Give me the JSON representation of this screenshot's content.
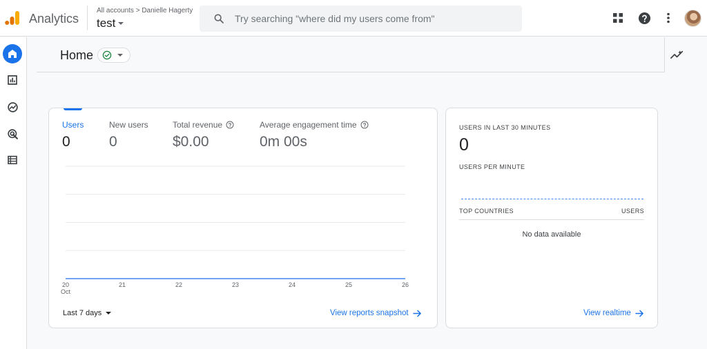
{
  "topbar": {
    "app_name": "Analytics",
    "breadcrumb": "All accounts > Danielle Hagerty",
    "property": "test",
    "search_placeholder": "Try searching \"where did my users come from\"",
    "icons": [
      "apps-grid-icon",
      "help-icon",
      "more-vert-icon",
      "avatar"
    ]
  },
  "nav": {
    "items": [
      {
        "name": "home",
        "icon": "home-icon",
        "active": true
      },
      {
        "name": "reports",
        "icon": "bar-chart-icon",
        "active": false
      },
      {
        "name": "explore",
        "icon": "explore-icon",
        "active": false
      },
      {
        "name": "advertising",
        "icon": "target-icon",
        "active": false
      },
      {
        "name": "configure",
        "icon": "list-icon",
        "active": false
      }
    ]
  },
  "page": {
    "title": "Home"
  },
  "metrics": [
    {
      "label": "Users",
      "value": "0",
      "active": true
    },
    {
      "label": "New users",
      "value": "0"
    },
    {
      "label": "Total revenue",
      "value": "$0.00"
    },
    {
      "label": "Average engagement time",
      "value": "0m 00s"
    }
  ],
  "chart_data": {
    "type": "line",
    "x": [
      "20",
      "21",
      "22",
      "23",
      "24",
      "25",
      "26"
    ],
    "x_sub": {
      "20": "Oct"
    },
    "series": [
      {
        "values": [
          0,
          0,
          0,
          0,
          0,
          0,
          0
        ],
        "color": "#4285f4"
      }
    ],
    "title": "",
    "xlabel": "",
    "ylabel": "",
    "grid": true
  },
  "main_card": {
    "range_label": "Last 7 days",
    "snapshot_link": "View reports snapshot"
  },
  "realtime": {
    "title": "USERS IN LAST 30 MINUTES",
    "count": "0",
    "per_minute_label": "USERS PER MINUTE",
    "col_countries": "TOP COUNTRIES",
    "col_users": "USERS",
    "empty_text": "No data available",
    "link": "View realtime"
  },
  "colors": {
    "accent": "#1a73e8",
    "line": "#4285f4",
    "logo_dark": "#e37400",
    "logo_light": "#f9ab00"
  }
}
